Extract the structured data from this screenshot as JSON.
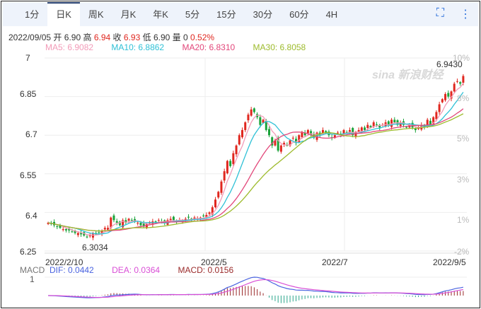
{
  "tabs": [
    "1分",
    "日K",
    "周K",
    "月K",
    "年K",
    "5分",
    "15分",
    "30分",
    "60分",
    "4H"
  ],
  "active_tab": "日K",
  "info": {
    "date": "2022/09/05",
    "open_label": "开",
    "open": "6.90",
    "high_label": "高",
    "high": "6.94",
    "close_label": "收",
    "close": "6.93",
    "low_label": "低",
    "low": "6.90",
    "vol_label": "量",
    "vol": "0",
    "change": "0.52%"
  },
  "ma": {
    "ma5": "MA5: 6.9082",
    "ma10": "MA10: 6.8862",
    "ma20": "MA20: 6.8310",
    "ma30": "MA30: 6.8058"
  },
  "colors": {
    "up": "#e0271f",
    "down": "#1aa33a",
    "ma5": "#f29bb8",
    "ma10": "#2fc1d6",
    "ma20": "#e2477a",
    "ma30": "#9dbb2c",
    "dif": "#4a63e0",
    "dea": "#d94fd6",
    "macd": "#9a2a2a"
  },
  "y_labels": [
    "7",
    "6.85",
    "6.7",
    "6.55",
    "6.4",
    "6.25"
  ],
  "pct_labels": [
    "10%",
    "8%",
    "5%",
    "3%",
    "1%",
    "-2%"
  ],
  "x_labels": [
    "2022/2/10",
    "2022/5",
    "2022/7",
    "2022/9/5"
  ],
  "max_label": "6.9430",
  "min_label": "6.3034",
  "watermark": "sina 新浪财经",
  "macd": {
    "title": "MACD",
    "dif": "DIF: 0.0442",
    "dea": "DEA: 0.0364",
    "macd": "MACD: 0.0156",
    "axis": "1"
  },
  "chart_data": {
    "type": "candlestick",
    "closes": [
      6.36,
      6.355,
      6.35,
      6.345,
      6.34,
      6.335,
      6.33,
      6.33,
      6.325,
      6.32,
      6.32,
      6.315,
      6.31,
      6.305,
      6.31,
      6.32,
      6.315,
      6.32,
      6.33,
      6.34,
      6.34,
      6.38,
      6.37,
      6.36,
      6.35,
      6.37,
      6.36,
      6.375,
      6.37,
      6.365,
      6.36,
      6.35,
      6.345,
      6.355,
      6.36,
      6.365,
      6.36,
      6.37,
      6.365,
      6.36,
      6.37,
      6.375,
      6.37,
      6.365,
      6.37,
      6.37,
      6.375,
      6.38,
      6.37,
      6.38,
      6.375,
      6.38,
      6.385,
      6.39,
      6.4,
      6.42,
      6.45,
      6.48,
      6.52,
      6.56,
      6.6,
      6.58,
      6.63,
      6.66,
      6.7,
      6.72,
      6.75,
      6.78,
      6.8,
      6.79,
      6.77,
      6.74,
      6.76,
      6.72,
      6.7,
      6.66,
      6.68,
      6.64,
      6.66,
      6.67,
      6.66,
      6.68,
      6.69,
      6.67,
      6.7,
      6.71,
      6.7,
      6.72,
      6.7,
      6.69,
      6.71,
      6.7,
      6.72,
      6.71,
      6.7,
      6.69,
      6.7,
      6.71,
      6.7,
      6.72,
      6.71,
      6.72,
      6.7,
      6.71,
      6.72,
      6.73,
      6.72,
      6.74,
      6.73,
      6.75,
      6.74,
      6.73,
      6.74,
      6.75,
      6.74,
      6.76,
      6.75,
      6.74,
      6.75,
      6.74,
      6.73,
      6.74,
      6.73,
      6.72,
      6.73,
      6.74,
      6.73,
      6.76,
      6.74,
      6.77,
      6.79,
      6.82,
      6.84,
      6.86,
      6.85,
      6.87,
      6.9,
      6.91,
      6.9,
      6.93
    ],
    "ylim": [
      6.25,
      7.0
    ]
  }
}
